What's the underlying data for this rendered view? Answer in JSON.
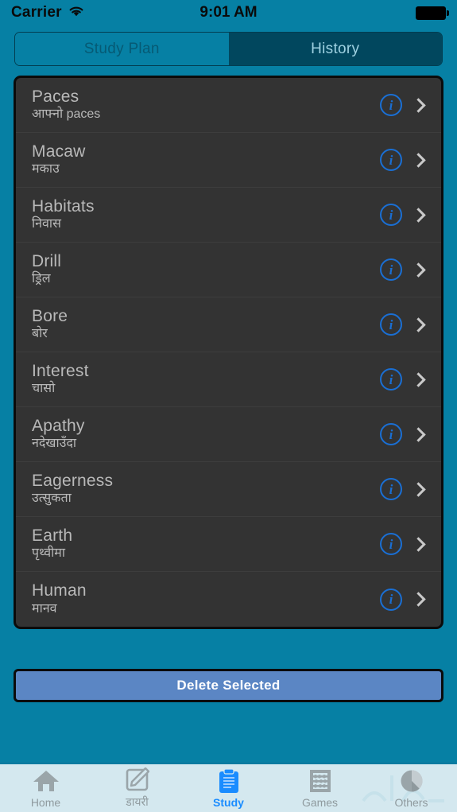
{
  "status_bar": {
    "carrier": "Carrier",
    "wifi_icon": "wifi-icon",
    "time": "9:01 AM",
    "battery_icon": "battery-full-icon"
  },
  "segmented_control": {
    "options": [
      {
        "label": "Study Plan",
        "selected": false
      },
      {
        "label": "History",
        "selected": true
      }
    ],
    "selected_color": "#01475e",
    "unselected_color": "#0680a4"
  },
  "list": {
    "items": [
      {
        "english": "Paces",
        "nepali": "आफ्नो paces"
      },
      {
        "english": "Macaw",
        "nepali": "मकाउ"
      },
      {
        "english": "Habitats",
        "nepali": "निवास"
      },
      {
        "english": "Drill",
        "nepali": "ड्रिल"
      },
      {
        "english": "Bore",
        "nepali": "बोर"
      },
      {
        "english": "Interest",
        "nepali": "चासो"
      },
      {
        "english": "Apathy",
        "nepali": "नदेखाउँदा"
      },
      {
        "english": "Eagerness",
        "nepali": "उत्सुकता"
      },
      {
        "english": "Earth",
        "nepali": "पृथ्वीमा"
      },
      {
        "english": "Human",
        "nepali": "मानव"
      }
    ],
    "info_icon": "info-circle-icon",
    "disclosure_icon": "chevron-right-icon",
    "info_color": "#1a6fd4",
    "background_color": "#333333"
  },
  "delete_button": {
    "label": "Delete Selected",
    "color": "#5b86c4"
  },
  "tab_bar": {
    "tabs": [
      {
        "label": "Home",
        "icon": "home-icon",
        "active": false
      },
      {
        "label": "डायरी",
        "icon": "compose-icon",
        "active": false
      },
      {
        "label": "Study",
        "icon": "clipboard-icon",
        "active": true
      },
      {
        "label": "Games",
        "icon": "abacus-icon",
        "active": false
      },
      {
        "label": "Others",
        "icon": "pie-chart-icon",
        "active": false
      }
    ],
    "active_color": "#1a8cff",
    "inactive_color": "#8f9a9e",
    "background_color": "#d4e8ef"
  },
  "theme": {
    "background": "#0680a4"
  }
}
